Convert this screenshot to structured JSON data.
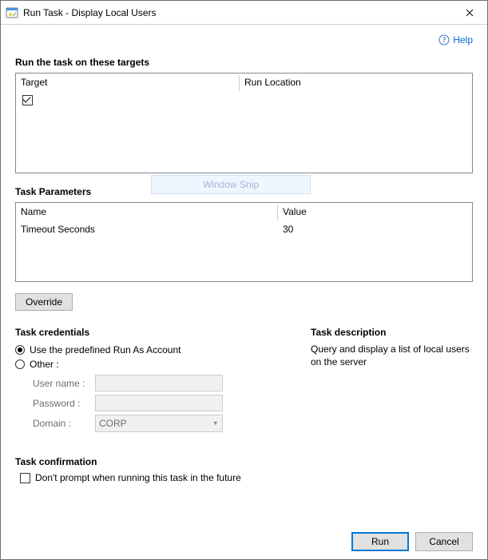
{
  "window": {
    "title": "Run Task - Display Local Users"
  },
  "help": {
    "label": "Help"
  },
  "targets": {
    "heading": "Run the task on these targets",
    "columns": {
      "target": "Target",
      "run_location": "Run Location"
    },
    "rows": [
      {
        "checked": true,
        "target": "",
        "run_location": ""
      }
    ]
  },
  "watermark": "Window Snip",
  "params": {
    "heading": "Task Parameters",
    "columns": {
      "name": "Name",
      "value": "Value"
    },
    "rows": [
      {
        "name": "Timeout Seconds",
        "value": "30"
      }
    ]
  },
  "override": {
    "label": "Override"
  },
  "credentials": {
    "heading": "Task credentials",
    "predefined_label": "Use the predefined Run As Account",
    "other_label": "Other :",
    "selected": "predefined",
    "username_label": "User name :",
    "password_label": "Password :",
    "domain_label": "Domain :",
    "username": "",
    "password": "",
    "domain": "CORP"
  },
  "description": {
    "heading": "Task description",
    "text": "Query and display a list of local users on the server"
  },
  "confirmation": {
    "heading": "Task confirmation",
    "label": "Don't prompt when running this task in the future",
    "checked": false
  },
  "footer": {
    "run": "Run",
    "cancel": "Cancel"
  }
}
